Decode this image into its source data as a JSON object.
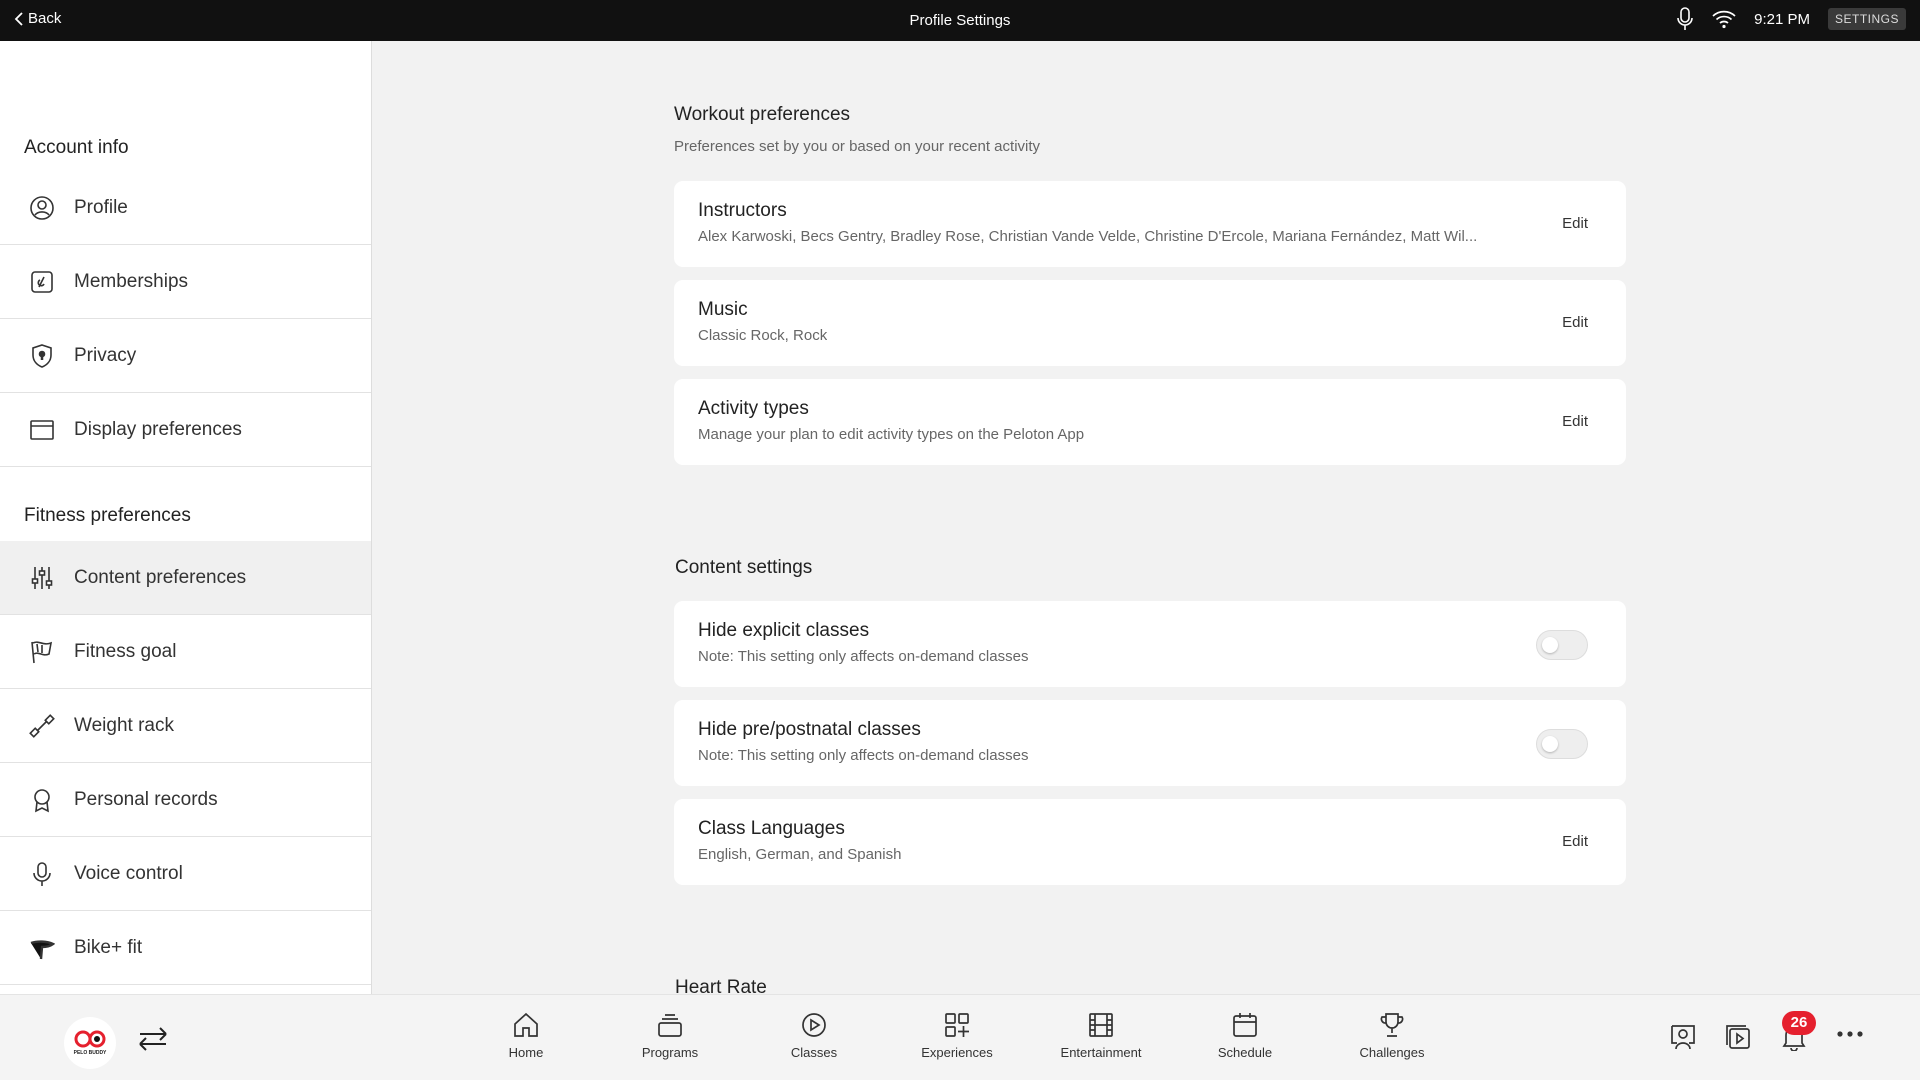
{
  "topbar": {
    "back_label": "Back",
    "title": "Profile Settings",
    "time": "9:21 PM",
    "settings_badge": "SETTINGS"
  },
  "sidebar": {
    "account_heading": "Account info",
    "account_items": [
      {
        "label": "Profile",
        "icon": "profile-icon"
      },
      {
        "label": "Memberships",
        "icon": "membership-icon"
      },
      {
        "label": "Privacy",
        "icon": "privacy-shield-icon"
      },
      {
        "label": "Display preferences",
        "icon": "display-icon"
      }
    ],
    "fitness_heading": "Fitness preferences",
    "fitness_items": [
      {
        "label": "Content preferences",
        "icon": "sliders-icon",
        "active": true
      },
      {
        "label": "Fitness goal",
        "icon": "flag-icon"
      },
      {
        "label": "Weight rack",
        "icon": "dumbbell-icon"
      },
      {
        "label": "Personal records",
        "icon": "award-icon"
      },
      {
        "label": "Voice control",
        "icon": "microphone-icon"
      },
      {
        "label": "Bike+ fit",
        "icon": "bike-seat-icon"
      }
    ]
  },
  "main": {
    "workout": {
      "title": "Workout preferences",
      "subtitle": "Preferences set by you or based on your recent activity",
      "cards": [
        {
          "title": "Instructors",
          "sub": "Alex Karwoski, Becs Gentry, Bradley Rose, Christian Vande Velde, Christine D'Ercole, Mariana Fernández, Matt Wil...",
          "action": "Edit"
        },
        {
          "title": "Music",
          "sub": "Classic Rock, Rock",
          "action": "Edit"
        },
        {
          "title": "Activity types",
          "sub": "Manage your plan to edit activity types on the Peloton App",
          "action": "Edit"
        }
      ]
    },
    "content": {
      "title": "Content settings",
      "cards": [
        {
          "title": "Hide explicit classes",
          "sub": "Note: This setting only affects on-demand classes",
          "toggle_on": false
        },
        {
          "title": "Hide pre/postnatal classes",
          "sub": "Note: This setting only affects on-demand classes",
          "toggle_on": false
        },
        {
          "title": "Class Languages",
          "sub": "English, German, and Spanish",
          "action": "Edit"
        }
      ]
    },
    "heart_rate_title": "Heart Rate"
  },
  "bottomnav": {
    "logo_text": "PELO BUDDY",
    "items": [
      {
        "label": "Home",
        "icon": "home-icon"
      },
      {
        "label": "Programs",
        "icon": "programs-icon"
      },
      {
        "label": "Classes",
        "icon": "play-circle-icon"
      },
      {
        "label": "Experiences",
        "icon": "experiences-icon"
      },
      {
        "label": "Entertainment",
        "icon": "film-icon"
      },
      {
        "label": "Schedule",
        "icon": "calendar-icon"
      },
      {
        "label": "Challenges",
        "icon": "trophy-icon"
      }
    ],
    "notification_count": "26"
  }
}
